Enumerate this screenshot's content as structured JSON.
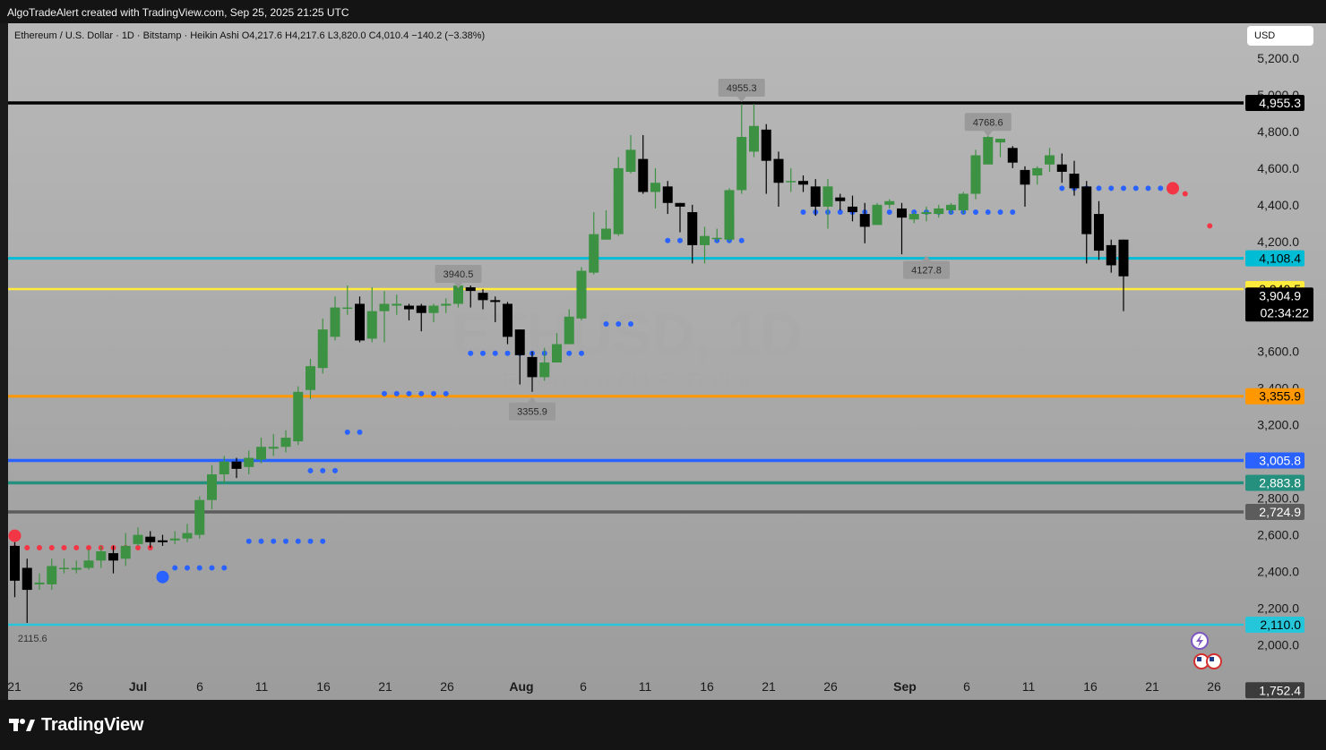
{
  "header": {
    "credit": "AlgoTradeAlert created with TradingView.com, Sep 25, 2025 21:25 UTC",
    "legend": "Ethereum / U.S. Dollar · 1D · Bitstamp · Heikin Ashi  O4,217.6  H4,217.6  L3,820.0  C4,010.4  −140.2 (−3.38%)",
    "currency": "USD"
  },
  "watermark": {
    "symbol": "ETHUSD, 1D",
    "name": "Ethereum / U.S. Dollar"
  },
  "footer": {
    "brand": "TradingView"
  },
  "colors": {
    "up": "#3d9142",
    "down": "#000000",
    "blue_dot": "#2962ff",
    "red_dot": "#f23645",
    "chart_bg_top": "#b8b8b8",
    "chart_bg_bottom": "#9c9c9c"
  },
  "chart_data": {
    "type": "candlestick",
    "title": "Ethereum / U.S. Dollar · 1D · Bitstamp · Heikin Ashi",
    "ylim": [
      1700,
      5390
    ],
    "y_ticks": [
      "2,000.0",
      "2,200.0",
      "2,400.0",
      "2,600.0",
      "2,800.0",
      "3,200.0",
      "3,400.0",
      "3,600.0",
      "4,200.0",
      "4,400.0",
      "4,600.0",
      "4,800.0",
      "5,000.0",
      "5,200.0"
    ],
    "x_ticks": [
      "21",
      "26",
      "Jul",
      "6",
      "11",
      "16",
      "21",
      "26",
      "Aug",
      "6",
      "11",
      "16",
      "21",
      "26",
      "Sep",
      "6",
      "11",
      "16",
      "21",
      "26"
    ],
    "candles": [
      [
        2540,
        2350,
        2560,
        2260
      ],
      [
        2420,
        2300,
        2470,
        2120
      ],
      [
        2330,
        2340,
        2390,
        2300
      ],
      [
        2330,
        2430,
        2470,
        2300
      ],
      [
        2420,
        2420,
        2470,
        2390
      ],
      [
        2410,
        2420,
        2460,
        2390
      ],
      [
        2420,
        2460,
        2520,
        2410
      ],
      [
        2460,
        2510,
        2540,
        2420
      ],
      [
        2500,
        2460,
        2540,
        2390
      ],
      [
        2470,
        2540,
        2610,
        2430
      ],
      [
        2550,
        2600,
        2640,
        2540
      ],
      [
        2590,
        2560,
        2620,
        2530
      ],
      [
        2570,
        2560,
        2600,
        2540
      ],
      [
        2570,
        2580,
        2620,
        2550
      ],
      [
        2580,
        2610,
        2660,
        2560
      ],
      [
        2600,
        2790,
        2810,
        2580
      ],
      [
        2790,
        2930,
        2980,
        2740
      ],
      [
        2930,
        3000,
        3030,
        2880
      ],
      [
        3000,
        2960,
        3020,
        2910
      ],
      [
        2970,
        3020,
        3060,
        2930
      ],
      [
        3010,
        3080,
        3130,
        2990
      ],
      [
        3070,
        3080,
        3150,
        3030
      ],
      [
        3080,
        3130,
        3170,
        3050
      ],
      [
        3110,
        3380,
        3410,
        3090
      ],
      [
        3390,
        3520,
        3560,
        3340
      ],
      [
        3510,
        3720,
        3780,
        3480
      ],
      [
        3680,
        3840,
        3900,
        3660
      ],
      [
        3840,
        3840,
        3960,
        3800
      ],
      [
        3860,
        3660,
        3900,
        3650
      ],
      [
        3670,
        3820,
        3950,
        3650
      ],
      [
        3820,
        3860,
        3930,
        3650
      ],
      [
        3850,
        3860,
        3910,
        3800
      ],
      [
        3850,
        3830,
        3860,
        3770
      ],
      [
        3850,
        3810,
        3860,
        3710
      ],
      [
        3810,
        3850,
        3860,
        3760
      ],
      [
        3850,
        3860,
        3890,
        3810
      ],
      [
        3860,
        3960,
        3980,
        3840
      ],
      [
        3950,
        3930,
        3960,
        3840
      ],
      [
        3920,
        3880,
        3940,
        3830
      ],
      [
        3880,
        3870,
        3900,
        3760
      ],
      [
        3860,
        3680,
        3870,
        3640
      ],
      [
        3720,
        3580,
        3720,
        3420
      ],
      [
        3570,
        3460,
        3600,
        3380
      ],
      [
        3460,
        3540,
        3620,
        3440
      ],
      [
        3540,
        3640,
        3700,
        3540
      ],
      [
        3640,
        3790,
        3830,
        3640
      ],
      [
        3780,
        4040,
        4060,
        3770
      ],
      [
        4030,
        4240,
        4360,
        4020
      ],
      [
        4210,
        4270,
        4370,
        4210
      ],
      [
        4240,
        4600,
        4660,
        4230
      ],
      [
        4580,
        4700,
        4780,
        4570
      ],
      [
        4650,
        4470,
        4780,
        4460
      ],
      [
        4470,
        4520,
        4600,
        4380
      ],
      [
        4500,
        4410,
        4530,
        4350
      ],
      [
        4410,
        4390,
        4410,
        4250
      ],
      [
        4360,
        4180,
        4400,
        4080
      ],
      [
        4180,
        4230,
        4280,
        4080
      ],
      [
        4220,
        4220,
        4270,
        4200
      ],
      [
        4210,
        4480,
        4490,
        4200
      ],
      [
        4480,
        4770,
        4950,
        4460
      ],
      [
        4690,
        4830,
        4950,
        4660
      ],
      [
        4810,
        4640,
        4840,
        4460
      ],
      [
        4650,
        4520,
        4690,
        4390
      ],
      [
        4530,
        4530,
        4600,
        4470
      ],
      [
        4530,
        4510,
        4560,
        4470
      ],
      [
        4500,
        4390,
        4540,
        4340
      ],
      [
        4390,
        4500,
        4540,
        4270
      ],
      [
        4440,
        4420,
        4460,
        4370
      ],
      [
        4390,
        4360,
        4450,
        4310
      ],
      [
        4350,
        4280,
        4410,
        4190
      ],
      [
        4290,
        4400,
        4410,
        4300
      ],
      [
        4400,
        4420,
        4430,
        4380
      ],
      [
        4380,
        4330,
        4410,
        4130
      ],
      [
        4320,
        4350,
        4360,
        4300
      ],
      [
        4350,
        4360,
        4390,
        4310
      ],
      [
        4350,
        4380,
        4400,
        4330
      ],
      [
        4370,
        4400,
        4410,
        4350
      ],
      [
        4370,
        4460,
        4470,
        4350
      ],
      [
        4460,
        4670,
        4700,
        4430
      ],
      [
        4620,
        4770,
        4790,
        4640
      ],
      [
        4740,
        4760,
        4760,
        4660
      ],
      [
        4710,
        4630,
        4720,
        4600
      ],
      [
        4590,
        4510,
        4610,
        4390
      ],
      [
        4560,
        4600,
        4610,
        4510
      ],
      [
        4620,
        4670,
        4710,
        4580
      ],
      [
        4620,
        4580,
        4680,
        4520
      ],
      [
        4570,
        4490,
        4640,
        4450
      ],
      [
        4500,
        4240,
        4530,
        4080
      ],
      [
        4350,
        4150,
        4420,
        4100
      ],
      [
        4180,
        4070,
        4210,
        4030
      ],
      [
        4210,
        4010,
        4210,
        3820
      ]
    ],
    "support_resistance": [
      {
        "label": "4,955.3",
        "value": 4955.3,
        "color": "#000000",
        "text_color": "#ffffff",
        "thickness": 3.5
      },
      {
        "label": "4,108.4",
        "value": 4108.4,
        "color": "#00bcd4",
        "text_color": "#000000",
        "thickness": 3
      },
      {
        "label": "3,940.5",
        "value": 3940.5,
        "color": "#ffeb3b",
        "text_color": "#000000",
        "thickness": 2.5
      },
      {
        "label": "3,355.9",
        "value": 3355.9,
        "color": "#ff9800",
        "text_color": "#000000",
        "thickness": 3
      },
      {
        "label": "3,005.8",
        "value": 3005.8,
        "color": "#2962ff",
        "text_color": "#ffffff",
        "thickness": 3.5
      },
      {
        "label": "2,883.8",
        "value": 2883.8,
        "color": "#26907e",
        "text_color": "#ffffff",
        "thickness": 3.5
      },
      {
        "label": "2,724.9",
        "value": 2724.9,
        "color": "#5c5c5c",
        "text_color": "#ffffff",
        "thickness": 3.5
      },
      {
        "label": "2,110.0",
        "value": 2110.0,
        "color": "#26c6da",
        "text_color": "#000000",
        "thickness": 2.5
      }
    ],
    "current_price": {
      "label": "3,904.9",
      "value": 3904.9,
      "countdown": "02:34:22"
    },
    "extra_axis_label": {
      "label": "1,752.4",
      "value": 1752.4
    },
    "annotations": [
      {
        "text": "4955.3",
        "bar": 59,
        "value": 4955.3,
        "style": "box_above"
      },
      {
        "text": "4768.6",
        "bar": 79,
        "value": 4768.6,
        "style": "box_above"
      },
      {
        "text": "3940.5",
        "bar": 36,
        "value": 3940.5,
        "style": "box_above"
      },
      {
        "text": "4127.8",
        "bar": 74,
        "value": 4127.8,
        "style": "box_below"
      },
      {
        "text": "3355.9",
        "bar": 42,
        "value": 3355.9,
        "style": "box_below"
      },
      {
        "text": "2115.6",
        "bar": 1,
        "value": 2115.6,
        "style": "plain_below"
      }
    ],
    "blue_dots": [
      {
        "from": 13,
        "to": 17,
        "value": 2420
      },
      {
        "from": 19,
        "to": 25,
        "value": 2565
      },
      {
        "from": 24,
        "to": 26,
        "value": 2950
      },
      {
        "from": 27,
        "to": 28,
        "value": 3160
      },
      {
        "from": 30,
        "to": 35,
        "value": 3370
      },
      {
        "from": 37,
        "to": 46,
        "value": 3590
      },
      {
        "from": 48,
        "to": 50,
        "value": 3750
      },
      {
        "from": 53,
        "to": 59,
        "value": 4205
      },
      {
        "from": 64,
        "to": 81,
        "value": 4360
      },
      {
        "from": 85,
        "to": 93,
        "value": 4490
      }
    ],
    "blue_big_dot": {
      "bar": 12,
      "value": 2370
    },
    "red_dots": [
      {
        "from": 0,
        "to": 11,
        "value": 2530
      },
      {
        "from": 95,
        "to": 95,
        "value": 4460
      },
      {
        "from": 97,
        "to": 97,
        "value": 4285
      }
    ],
    "red_big_dots": [
      {
        "bar": 0,
        "value": 2595
      },
      {
        "bar": 94,
        "value": 4490
      }
    ]
  }
}
